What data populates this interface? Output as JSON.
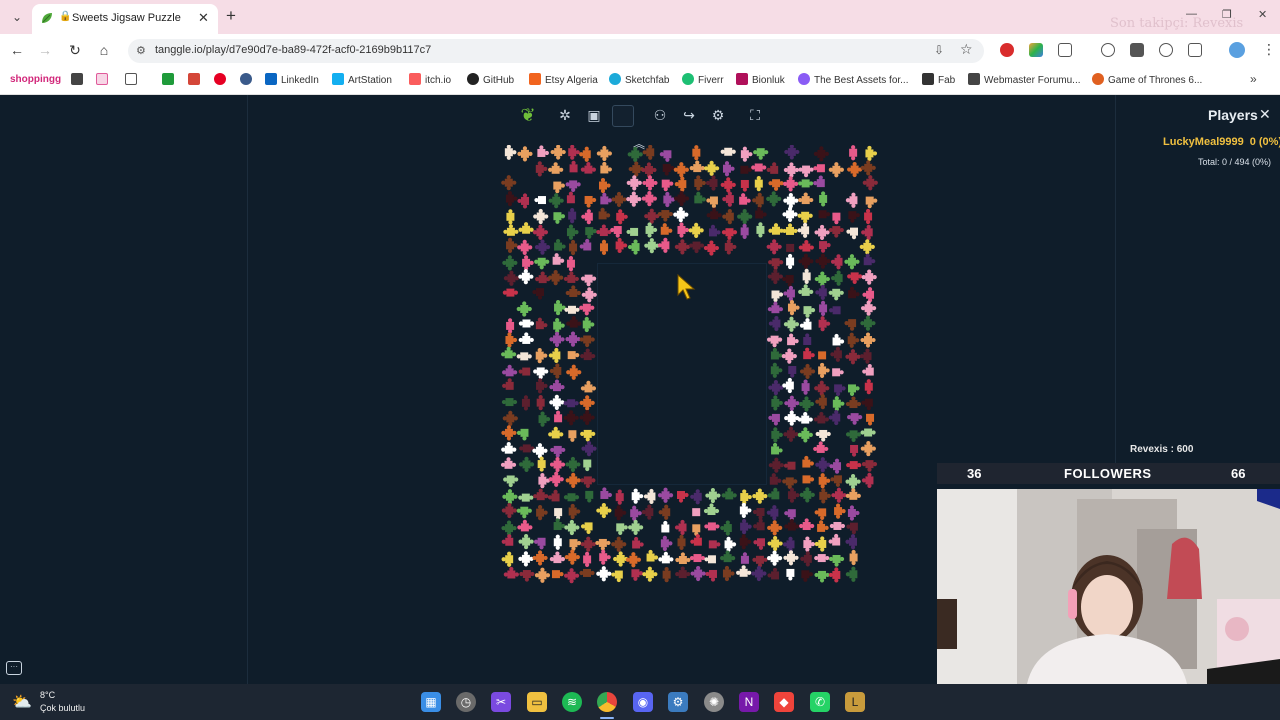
{
  "browser": {
    "tab_title": "Sweets Jigsaw Puzzle",
    "url": "tanggle.io/play/d7e90d7e-ba89-472f-acf0-2169b9b117c7",
    "watermark": "Son takipçi: Revexis",
    "bookmarks": [
      {
        "label": "shoppingg",
        "color": "#d2277a"
      },
      {
        "label": "",
        "color": "#444444"
      },
      {
        "label": "",
        "color": "#e05a9a"
      },
      {
        "label": "",
        "color": "#555555"
      },
      {
        "label": "",
        "color": "#1f9b3a"
      },
      {
        "label": "",
        "color": "#d44638"
      },
      {
        "label": "",
        "color": "#e60023"
      },
      {
        "label": "",
        "color": "#3a5a8a"
      },
      {
        "label": "LinkedIn",
        "color": "#0a66c2"
      },
      {
        "label": "ArtStation",
        "color": "#13aff0"
      },
      {
        "label": "itch.io",
        "color": "#fa5c5c"
      },
      {
        "label": "GitHub",
        "color": "#222222"
      },
      {
        "label": "Etsy Algeria",
        "color": "#f1641e"
      },
      {
        "label": "Sketchfab",
        "color": "#1caad9"
      },
      {
        "label": "Fiverr",
        "color": "#1dbf73"
      },
      {
        "label": "Bionluk",
        "color": "#b0105a"
      },
      {
        "label": "The Best Assets for...",
        "color": "#8a5cf5"
      },
      {
        "label": "Fab",
        "color": "#333333"
      },
      {
        "label": "Webmaster Forumu...",
        "color": "#444444"
      },
      {
        "label": "Game of Thrones 6...",
        "color": "#e06020"
      }
    ]
  },
  "game": {
    "tools": [
      "logo-icon",
      "puzzle-icon",
      "image-icon",
      "preview-box",
      "users-icon",
      "share-icon",
      "settings-icon",
      "fullscreen-icon"
    ],
    "players_title": "Players",
    "player": {
      "name": "LuckyMeal9999",
      "score": "0 (0%)"
    },
    "total": "Total: 0 / 494 (0%)"
  },
  "overlay": {
    "follower_name": "Revexis : 600",
    "start": "36",
    "label": "FOLLOWERS",
    "goal": "66",
    "progress": 0.0
  },
  "taskbar": {
    "temp": "8°C",
    "desc": "Çok bulutlu",
    "apps": [
      {
        "name": "windows-start-icon",
        "color": "#3a8ee6"
      },
      {
        "name": "clock-app-icon",
        "color": "#6a6a6a"
      },
      {
        "name": "snipping-tool-icon",
        "color": "#7a4ae0"
      },
      {
        "name": "file-explorer-icon",
        "color": "#f0c040"
      },
      {
        "name": "spotify-icon",
        "color": "#1db954"
      },
      {
        "name": "chrome-icon",
        "color": "#e8453c"
      },
      {
        "name": "discord-icon",
        "color": "#5865f2"
      },
      {
        "name": "steam-icon",
        "color": "#3b7bbf"
      },
      {
        "name": "settings-app-icon",
        "color": "#8a8a8a"
      },
      {
        "name": "onenote-icon",
        "color": "#7719aa"
      },
      {
        "name": "anydesk-icon",
        "color": "#ef443b"
      },
      {
        "name": "whatsapp-icon",
        "color": "#25d366"
      },
      {
        "name": "league-icon",
        "color": "#c89b3c"
      }
    ]
  }
}
